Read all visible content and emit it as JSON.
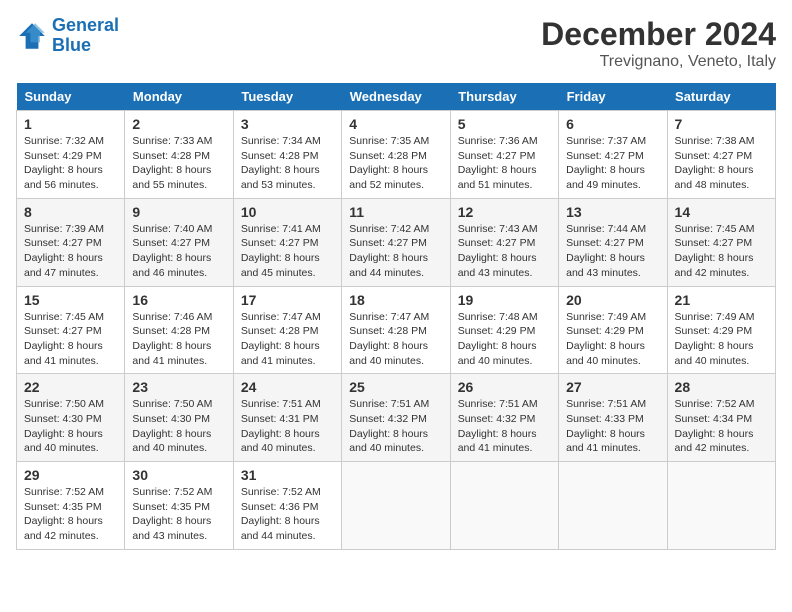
{
  "header": {
    "logo_line1": "General",
    "logo_line2": "Blue",
    "month": "December 2024",
    "location": "Trevignano, Veneto, Italy"
  },
  "weekdays": [
    "Sunday",
    "Monday",
    "Tuesday",
    "Wednesday",
    "Thursday",
    "Friday",
    "Saturday"
  ],
  "weeks": [
    [
      {
        "day": 1,
        "sunrise": "7:32 AM",
        "sunset": "4:29 PM",
        "daylight": "8 hours and 56 minutes."
      },
      {
        "day": 2,
        "sunrise": "7:33 AM",
        "sunset": "4:28 PM",
        "daylight": "8 hours and 55 minutes."
      },
      {
        "day": 3,
        "sunrise": "7:34 AM",
        "sunset": "4:28 PM",
        "daylight": "8 hours and 53 minutes."
      },
      {
        "day": 4,
        "sunrise": "7:35 AM",
        "sunset": "4:28 PM",
        "daylight": "8 hours and 52 minutes."
      },
      {
        "day": 5,
        "sunrise": "7:36 AM",
        "sunset": "4:27 PM",
        "daylight": "8 hours and 51 minutes."
      },
      {
        "day": 6,
        "sunrise": "7:37 AM",
        "sunset": "4:27 PM",
        "daylight": "8 hours and 49 minutes."
      },
      {
        "day": 7,
        "sunrise": "7:38 AM",
        "sunset": "4:27 PM",
        "daylight": "8 hours and 48 minutes."
      }
    ],
    [
      {
        "day": 8,
        "sunrise": "7:39 AM",
        "sunset": "4:27 PM",
        "daylight": "8 hours and 47 minutes."
      },
      {
        "day": 9,
        "sunrise": "7:40 AM",
        "sunset": "4:27 PM",
        "daylight": "8 hours and 46 minutes."
      },
      {
        "day": 10,
        "sunrise": "7:41 AM",
        "sunset": "4:27 PM",
        "daylight": "8 hours and 45 minutes."
      },
      {
        "day": 11,
        "sunrise": "7:42 AM",
        "sunset": "4:27 PM",
        "daylight": "8 hours and 44 minutes."
      },
      {
        "day": 12,
        "sunrise": "7:43 AM",
        "sunset": "4:27 PM",
        "daylight": "8 hours and 43 minutes."
      },
      {
        "day": 13,
        "sunrise": "7:44 AM",
        "sunset": "4:27 PM",
        "daylight": "8 hours and 43 minutes."
      },
      {
        "day": 14,
        "sunrise": "7:45 AM",
        "sunset": "4:27 PM",
        "daylight": "8 hours and 42 minutes."
      }
    ],
    [
      {
        "day": 15,
        "sunrise": "7:45 AM",
        "sunset": "4:27 PM",
        "daylight": "8 hours and 41 minutes."
      },
      {
        "day": 16,
        "sunrise": "7:46 AM",
        "sunset": "4:28 PM",
        "daylight": "8 hours and 41 minutes."
      },
      {
        "day": 17,
        "sunrise": "7:47 AM",
        "sunset": "4:28 PM",
        "daylight": "8 hours and 41 minutes."
      },
      {
        "day": 18,
        "sunrise": "7:47 AM",
        "sunset": "4:28 PM",
        "daylight": "8 hours and 40 minutes."
      },
      {
        "day": 19,
        "sunrise": "7:48 AM",
        "sunset": "4:29 PM",
        "daylight": "8 hours and 40 minutes."
      },
      {
        "day": 20,
        "sunrise": "7:49 AM",
        "sunset": "4:29 PM",
        "daylight": "8 hours and 40 minutes."
      },
      {
        "day": 21,
        "sunrise": "7:49 AM",
        "sunset": "4:29 PM",
        "daylight": "8 hours and 40 minutes."
      }
    ],
    [
      {
        "day": 22,
        "sunrise": "7:50 AM",
        "sunset": "4:30 PM",
        "daylight": "8 hours and 40 minutes."
      },
      {
        "day": 23,
        "sunrise": "7:50 AM",
        "sunset": "4:30 PM",
        "daylight": "8 hours and 40 minutes."
      },
      {
        "day": 24,
        "sunrise": "7:51 AM",
        "sunset": "4:31 PM",
        "daylight": "8 hours and 40 minutes."
      },
      {
        "day": 25,
        "sunrise": "7:51 AM",
        "sunset": "4:32 PM",
        "daylight": "8 hours and 40 minutes."
      },
      {
        "day": 26,
        "sunrise": "7:51 AM",
        "sunset": "4:32 PM",
        "daylight": "8 hours and 41 minutes."
      },
      {
        "day": 27,
        "sunrise": "7:51 AM",
        "sunset": "4:33 PM",
        "daylight": "8 hours and 41 minutes."
      },
      {
        "day": 28,
        "sunrise": "7:52 AM",
        "sunset": "4:34 PM",
        "daylight": "8 hours and 42 minutes."
      }
    ],
    [
      {
        "day": 29,
        "sunrise": "7:52 AM",
        "sunset": "4:35 PM",
        "daylight": "8 hours and 42 minutes."
      },
      {
        "day": 30,
        "sunrise": "7:52 AM",
        "sunset": "4:35 PM",
        "daylight": "8 hours and 43 minutes."
      },
      {
        "day": 31,
        "sunrise": "7:52 AM",
        "sunset": "4:36 PM",
        "daylight": "8 hours and 44 minutes."
      },
      null,
      null,
      null,
      null
    ]
  ]
}
